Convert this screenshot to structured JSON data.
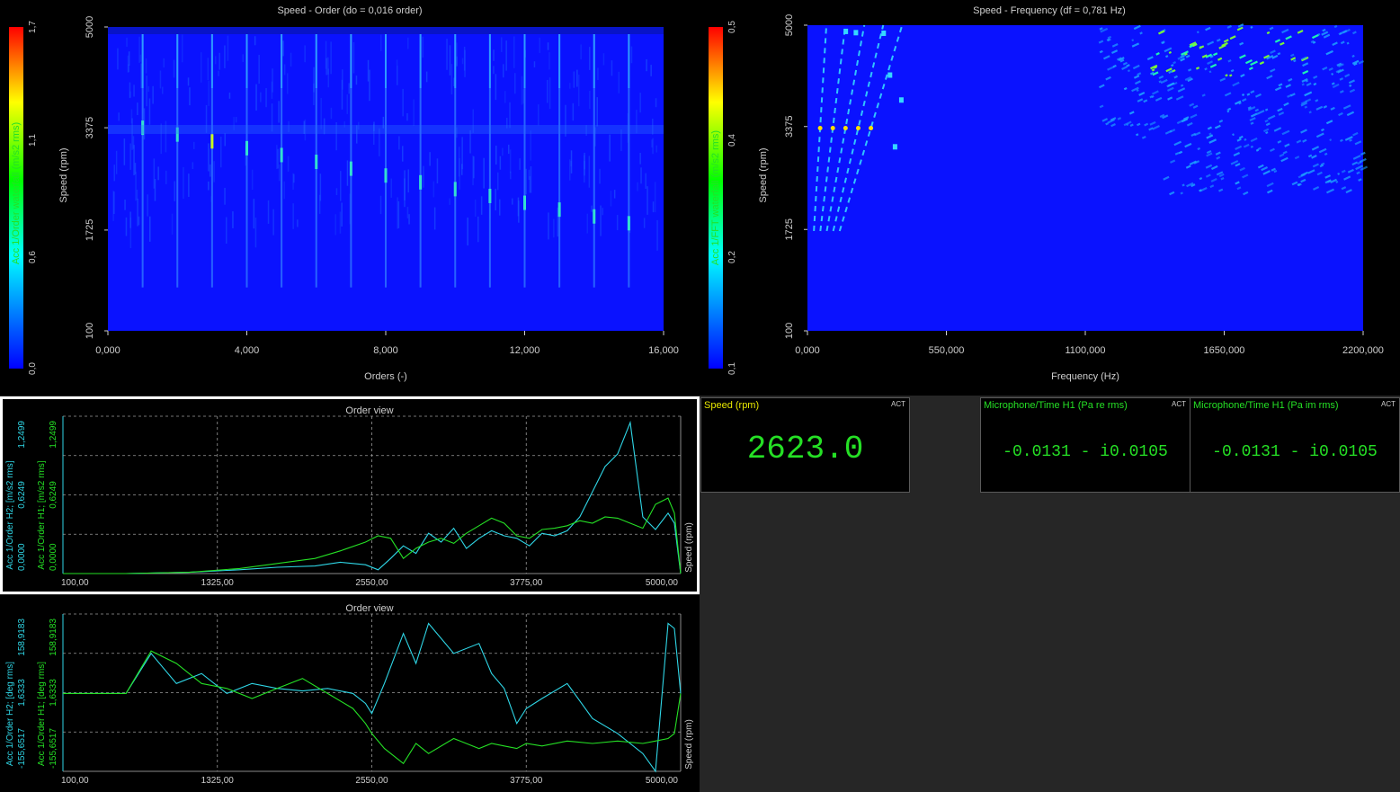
{
  "colors": {
    "background": "#000000",
    "desktop": "#262626",
    "text": "#cfcfcf",
    "cyan_trace": "#2fd6e6",
    "green_trace": "#25e025",
    "waterfall_low": "#0a12ff",
    "highlight_border": "#ffffff"
  },
  "waterfall_order": {
    "title": "Speed - Order (do = 0,016 order)",
    "ylabel": "Speed (rpm)",
    "xlabel": "Orders (-)",
    "colorbar_label": "Acc 1/Order waterfall (m/s2 rms)",
    "y_ticks": [
      "5000",
      "3375",
      "1725",
      "100"
    ],
    "x_ticks": [
      "0,000",
      "4,000",
      "8,000",
      "12,000",
      "16,000"
    ],
    "colorbar_ticks": [
      "1,7",
      "1,1",
      "0,6",
      "0,0"
    ]
  },
  "waterfall_freq": {
    "title": "Speed - Frequency (df = 0,781 Hz)",
    "ylabel": "Speed (rpm)",
    "xlabel": "Frequency (Hz)",
    "colorbar_label": "Acc 1/FFT waterfall (m/s2 rms)",
    "y_ticks": [
      "5000",
      "3375",
      "1725",
      "100"
    ],
    "x_ticks": [
      "0,000",
      "550,000",
      "1100,000",
      "1650,000",
      "2200,000"
    ],
    "colorbar_ticks": [
      "0,5",
      "0,4",
      "0,2",
      "0,1"
    ]
  },
  "order_view_amplitude": {
    "title": "Order view",
    "ylabel_h2": "Acc 1/Order H2; [m/s2 rms]",
    "ylabel_h1": "Acc 1/Order H1; [m/s2 rms]",
    "ylabel_right": "Speed (rpm)",
    "y_ticks_h2": [
      "1,2499",
      "0,6249",
      "0,0000"
    ],
    "y_ticks_h1": [
      "1,2499",
      "0,6249",
      "0,0000"
    ],
    "x_ticks": [
      "100,00",
      "1325,00",
      "2550,00",
      "3775,00",
      "5000,00"
    ]
  },
  "order_view_phase": {
    "title": "Order view",
    "ylabel_h2": "Acc 1/Order H2; [deg rms]",
    "ylabel_h1": "Acc 1/Order H1; [deg rms]",
    "ylabel_right": "Speed (rpm)",
    "y_ticks_h2": [
      "158,9183",
      "1,6333",
      "-155,6517"
    ],
    "y_ticks_h1": [
      "158,9183",
      "1,6333",
      "-155,6517"
    ],
    "x_ticks": [
      "100,00",
      "1325,00",
      "2550,00",
      "3775,00",
      "5000,00"
    ]
  },
  "meters": {
    "speed": {
      "label": "Speed (rpm)",
      "badge": "ACT",
      "value": "2623.0"
    },
    "mic_re": {
      "label": "Microphone/Time H1 (Pa re rms)",
      "badge": "ACT",
      "value": "-0.0131 - i0.0105"
    },
    "mic_im": {
      "label": "Microphone/Time H1 (Pa im rms)",
      "badge": "ACT",
      "value": "-0.0131 - i0.0105"
    }
  },
  "chart_data": [
    {
      "type": "heatmap",
      "title": "Speed - Order (do = 0,016 order)",
      "xlabel": "Orders (-)",
      "ylabel": "Speed (rpm)",
      "xlim": [
        0,
        16
      ],
      "ylim": [
        100,
        5000
      ],
      "colorbar": {
        "label": "Acc 1/Order waterfall (m/s2 rms)",
        "range": [
          0.0,
          1.7
        ]
      },
      "peak_orders": [
        1,
        2,
        3,
        4,
        5,
        6,
        7,
        8,
        9,
        10,
        11,
        12,
        13,
        14,
        15
      ]
    },
    {
      "type": "heatmap",
      "title": "Speed - Frequency (df = 0,781 Hz)",
      "xlabel": "Frequency (Hz)",
      "ylabel": "Speed (rpm)",
      "xlim": [
        0,
        2200
      ],
      "ylim": [
        100,
        5000
      ],
      "colorbar": {
        "label": "Acc 1/FFT waterfall (m/s2 rms)",
        "range": [
          0.1,
          0.5
        ]
      }
    },
    {
      "type": "line",
      "title": "Order view",
      "xlabel": "",
      "ylabel": "Acc 1/Order H2; [m/s2 rms]",
      "xlim": [
        100,
        5000
      ],
      "ylim": [
        0,
        1.2499
      ],
      "x": [
        100,
        600,
        1100,
        1500,
        1800,
        2100,
        2300,
        2500,
        2600,
        2700,
        2800,
        2900,
        3000,
        3100,
        3200,
        3300,
        3400,
        3500,
        3600,
        3700,
        3800,
        3900,
        4000,
        4100,
        4200,
        4300,
        4400,
        4500,
        4600,
        4700,
        4800,
        4900,
        4950,
        5000
      ],
      "series": [
        {
          "name": "Acc 1/Order H2",
          "color": "#2fd6e6",
          "values": [
            0,
            0,
            0.01,
            0.03,
            0.05,
            0.06,
            0.09,
            0.07,
            0.03,
            0.12,
            0.22,
            0.16,
            0.32,
            0.25,
            0.36,
            0.2,
            0.28,
            0.34,
            0.3,
            0.28,
            0.22,
            0.32,
            0.3,
            0.34,
            0.45,
            0.65,
            0.85,
            0.95,
            1.2,
            0.45,
            0.35,
            0.48,
            0.4,
            0.0
          ]
        },
        {
          "name": "Acc 1/Order H1",
          "color": "#25e025",
          "values": [
            0,
            0,
            0.01,
            0.04,
            0.08,
            0.12,
            0.18,
            0.25,
            0.3,
            0.28,
            0.12,
            0.2,
            0.25,
            0.28,
            0.24,
            0.32,
            0.38,
            0.44,
            0.4,
            0.3,
            0.28,
            0.35,
            0.36,
            0.38,
            0.42,
            0.4,
            0.45,
            0.44,
            0.4,
            0.36,
            0.55,
            0.6,
            0.48,
            0.0
          ]
        }
      ]
    },
    {
      "type": "line",
      "title": "Order view",
      "xlabel": "",
      "ylabel": "Acc 1/Order H2; [deg rms]",
      "xlim": [
        100,
        5000
      ],
      "ylim": [
        -155.6517,
        158.9183
      ],
      "x": [
        100,
        600,
        800,
        1000,
        1200,
        1400,
        1600,
        1800,
        2000,
        2200,
        2400,
        2500,
        2550,
        2650,
        2800,
        2900,
        3000,
        3200,
        3400,
        3500,
        3600,
        3700,
        3775,
        3900,
        4100,
        4300,
        4500,
        4700,
        4800,
        4900,
        4950,
        5000
      ],
      "series": [
        {
          "name": "Acc 1/Order H2",
          "color": "#2fd6e6",
          "values": [
            0,
            0,
            80,
            20,
            40,
            0,
            20,
            10,
            5,
            10,
            0,
            -20,
            -40,
            20,
            120,
            60,
            140,
            80,
            100,
            40,
            10,
            -60,
            -30,
            -10,
            20,
            -50,
            -80,
            -120,
            -170,
            140,
            130,
            0
          ]
        },
        {
          "name": "Acc 1/Order H1",
          "color": "#25e025",
          "values": [
            0,
            0,
            85,
            60,
            20,
            10,
            -10,
            10,
            30,
            0,
            -30,
            -60,
            -80,
            -110,
            -140,
            -100,
            -120,
            -90,
            -110,
            -100,
            -105,
            -110,
            -100,
            -105,
            -95,
            -100,
            -95,
            -100,
            -95,
            -90,
            -80,
            0
          ]
        }
      ]
    }
  ]
}
